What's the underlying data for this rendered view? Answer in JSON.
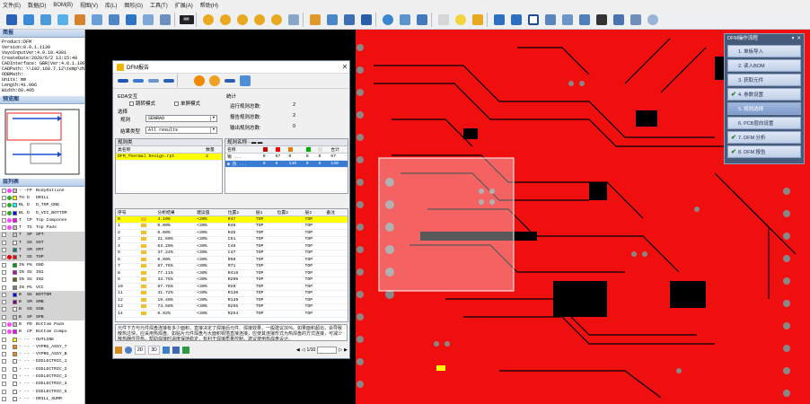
{
  "menu": [
    "文件(E)",
    "数据(D)",
    "BOM(B)",
    "视图(V)",
    "库(L)",
    "图形(G)",
    "工具(T)",
    "扩展(A)",
    "帮助(H)"
  ],
  "toolbar": {
    "mm_label": "MM"
  },
  "summary": {
    "title": "简报",
    "lines": [
      "Product:DFM",
      "Version:8.0.1.1130",
      "VayoInputVer:4.0.10.4381",
      "CreateDate:2020/6/2 13:15:40",
      "CADInterface: GBR(Ver:4.0.1.100",
      "CADPath: \\\\192.168.7.12\\temp\\dt",
      "ODBMath:",
      "Units: mm",
      "Length:41.006",
      "Width:60.495"
    ]
  },
  "preview": {
    "title": "预览图"
  },
  "layers": {
    "title": "层列表",
    "rows": [
      {
        "type": "- -",
        "side": "FP",
        "name": "BodyOutline",
        "dot": "#ff44ff",
        "color": "#c0c0c0"
      },
      {
        "type": "TH",
        "side": "D",
        "name": "DRILL",
        "dot": "#2fa82f",
        "color": "#ffff00"
      },
      {
        "type": "BL",
        "side": "D",
        "name": "D_TOP_GND",
        "dot": "#2fa82f",
        "color": "#00ffff"
      },
      {
        "type": "BL",
        "side": "D",
        "name": "D_VCC_BOTTOM",
        "dot": "#2fa82f",
        "color": "#0000ff"
      },
      {
        "type": "T",
        "side": "CP",
        "name": "Top Componen",
        "dot": "#ff44ff",
        "color": "#ff00ff"
      },
      {
        "type": "T",
        "side": "TG",
        "name": "Top Pads",
        "dot": "#ff44ff",
        "color": "#c0c0c0"
      },
      {
        "type": "T",
        "side": "SP",
        "name": "SPT",
        "dot": "",
        "color": "#c8c8c8"
      },
      {
        "type": "T",
        "side": "SS",
        "name": "SST",
        "dot": "",
        "color": "#ffffff"
      },
      {
        "type": "T",
        "side": "SM",
        "name": "SMT",
        "dot": "",
        "color": "#008080"
      },
      {
        "type": "T",
        "side": "SG",
        "name": "TOP",
        "dot": "#e00000",
        "color": "#ff0000"
      },
      {
        "type": "IN",
        "side": "PG",
        "name": "GND",
        "dot": "",
        "color": "#00a000"
      },
      {
        "type": "IN",
        "side": "SG",
        "name": "IN1",
        "dot": "",
        "color": "#c000c0"
      },
      {
        "type": "IN",
        "side": "SG",
        "name": "IN2",
        "dot": "",
        "color": "#606000"
      },
      {
        "type": "IN",
        "side": "PG",
        "name": "VCC",
        "dot": "",
        "color": "#808080"
      },
      {
        "type": "B",
        "side": "SG",
        "name": "BOTTOM",
        "dot": "",
        "color": "#0000ff"
      },
      {
        "type": "B",
        "side": "SM",
        "name": "SMB",
        "dot": "",
        "color": "#800080"
      },
      {
        "type": "B",
        "side": "SS",
        "name": "SSB",
        "dot": "",
        "color": "#ffffff"
      },
      {
        "type": "B",
        "side": "SP",
        "name": "SPB",
        "dot": "",
        "color": "#c8c8c8"
      },
      {
        "type": "B",
        "side": "PD",
        "name": "Bottom Pads",
        "dot": "#ff44ff",
        "color": "#c0c0c0"
      },
      {
        "type": "B",
        "side": "CP",
        "name": "Bottom Compo",
        "dot": "#ff44ff",
        "color": "#ff00ff"
      },
      {
        "type": "- -",
        "side": "- -",
        "name": "OUTLINE",
        "dot": "",
        "color": "#ffff00"
      },
      {
        "type": "- -",
        "side": "- -",
        "name": "VYPRG_ASSY_T",
        "dot": "",
        "color": "#ff8800"
      },
      {
        "type": "- -",
        "side": "- -",
        "name": "VYPRG_ASSY_B",
        "dot": "",
        "color": "#ff8800"
      },
      {
        "type": "- -",
        "side": "- -",
        "name": "DIELECTRIC_1",
        "dot": "",
        "color": "#ffffff"
      },
      {
        "type": "- -",
        "side": "- -",
        "name": "DIELECTRIC_2",
        "dot": "",
        "color": "#ffffff"
      },
      {
        "type": "- -",
        "side": "- -",
        "name": "DIELECTRIC_3",
        "dot": "",
        "color": "#ffffff"
      },
      {
        "type": "- -",
        "side": "- -",
        "name": "DIELECTRIC_4",
        "dot": "",
        "color": "#ffffff"
      },
      {
        "type": "- -",
        "side": "- -",
        "name": "DIELECTRIC_5",
        "dot": "",
        "color": "#ffffff"
      },
      {
        "type": "- -",
        "side": "- -",
        "name": "DRILL_SUMM",
        "dot": "",
        "color": "#ffffff"
      }
    ]
  },
  "dialog": {
    "title": "DFM报告",
    "eda_label": "EDA交互",
    "jump_mode": "跳转模式",
    "single_mode": "单屏模式",
    "select_label": "选择",
    "rule_label": "规则",
    "rule_value": "SENRAO",
    "result_label": "结果类型",
    "result_value": "All results",
    "stats_label": "统计",
    "stats": [
      {
        "label": "运行规则总数:",
        "value": "2"
      },
      {
        "label": "报告规则总数:",
        "value": "2"
      },
      {
        "label": "输出规则总数:",
        "value": "0"
      }
    ],
    "ruleclass": {
      "title": "规则类",
      "headers": [
        "类名称",
        "数量"
      ],
      "rows": [
        {
          "name": "DFM_Thermal Design.rpt",
          "count": "2"
        }
      ]
    },
    "rulename": {
      "title": "规则名称 - ▬ ▬",
      "headers": [
        "名称",
        "",
        "",
        "",
        "",
        "",
        "合计"
      ],
      "rows": [
        {
          "name": "锡 ...",
          "v": [
            "0",
            "67",
            "0",
            "0",
            "0"
          ],
          "total": "67"
        },
        {
          "name": "■ 热 ...",
          "v": [
            "0",
            "0",
            "140",
            "0",
            "0"
          ],
          "total": "140"
        }
      ]
    },
    "results": {
      "headers": [
        "序号",
        "",
        "分析结果",
        "建议值",
        "位置1",
        "层1",
        "位置2",
        "层2",
        "备注"
      ],
      "rows": [
        {
          "no": "0",
          "result": "4.10%",
          "advice": "<30%",
          "pos1": "R47",
          "layer1": "TOP",
          "pos2": "",
          "layer2": "TOP"
        },
        {
          "no": "1",
          "result": "0.00%",
          "advice": "<30%",
          "pos1": "R46",
          "layer1": "TOP",
          "pos2": "",
          "layer2": "TOP"
        },
        {
          "no": "2",
          "result": "0.00%",
          "advice": "<30%",
          "pos1": "R45",
          "layer1": "TOP",
          "pos2": "",
          "layer2": "TOP"
        },
        {
          "no": "3",
          "result": "21.60%",
          "advice": "<30%",
          "pos1": "C51",
          "layer1": "TOP",
          "pos2": "",
          "layer2": "TOP"
        },
        {
          "no": "4",
          "result": "63.20%",
          "advice": "<30%",
          "pos1": "C48",
          "layer1": "TOP",
          "pos2": "",
          "layer2": "TOP"
        },
        {
          "no": "5",
          "result": "37.24%",
          "advice": "<30%",
          "pos1": "C47",
          "layer1": "TOP",
          "pos2": "",
          "layer2": "TOP"
        },
        {
          "no": "6",
          "result": "0.00%",
          "advice": "<30%",
          "pos1": "R50",
          "layer1": "TOP",
          "pos2": "",
          "layer2": "TOP"
        },
        {
          "no": "7",
          "result": "87.76%",
          "advice": "<30%",
          "pos1": "R71",
          "layer1": "TOP",
          "pos2": "",
          "layer2": "TOP"
        },
        {
          "no": "8",
          "result": "77.11%",
          "advice": "<30%",
          "pos1": "R416",
          "layer1": "TOP",
          "pos2": "",
          "layer2": "TOP"
        },
        {
          "no": "9",
          "result": "33.75%",
          "advice": "<30%",
          "pos1": "R206",
          "layer1": "TOP",
          "pos2": "",
          "layer2": "TOP"
        },
        {
          "no": "10",
          "result": "87.76%",
          "advice": "<30%",
          "pos1": "R20",
          "layer1": "TOP",
          "pos2": "",
          "layer2": "TOP"
        },
        {
          "no": "11",
          "result": "41.72%",
          "advice": "<30%",
          "pos1": "R130",
          "layer1": "TOP",
          "pos2": "",
          "layer2": "TOP"
        },
        {
          "no": "12",
          "result": "19.40%",
          "advice": "<30%",
          "pos1": "R139",
          "layer1": "TOP",
          "pos2": "",
          "layer2": "TOP"
        },
        {
          "no": "13",
          "result": "74.58%",
          "advice": "<30%",
          "pos1": "R255",
          "layer1": "TOP",
          "pos2": "",
          "layer2": "TOP"
        },
        {
          "no": "14",
          "result": "0.92%",
          "advice": "<30%",
          "pos1": "R254",
          "layer1": "TOP",
          "pos2": "",
          "layer2": "TOP"
        }
      ]
    },
    "notes": "元件下方与元件焊盘连接有多少面积，直接决定了焊接后元件、焊接效果，一般建议30%。如果面积超出，会导致散热过快，应采用热焊盘。如贴片元件焊盘与大面积铜箔直接连接，应使其连接形式为热焊盘的方式连接，可减少散热器件导热，帮助焊接时温度保持稳定，有利于焊接质量控制，建议使用热焊盘设计。",
    "footer": {
      "btn_2d": "2D",
      "btn_3d": "3D",
      "page": "1/10"
    }
  },
  "flow": {
    "title": "DFM操作流程",
    "steps": [
      {
        "label": "1. 单板导入",
        "checked": false,
        "active": false
      },
      {
        "label": "2. 读入BOM",
        "checked": false,
        "active": false
      },
      {
        "label": "3. 获取元件",
        "checked": false,
        "active": false
      },
      {
        "label": "4. 参数设置",
        "checked": true,
        "active": false
      },
      {
        "label": "5. 规则选择",
        "checked": false,
        "active": true
      },
      {
        "label": "6. PCB层向设置",
        "checked": false,
        "active": false
      },
      {
        "label": "7. DFM 分析",
        "checked": true,
        "active": false
      },
      {
        "label": "8. DFM 报告",
        "checked": true,
        "active": false
      }
    ]
  }
}
